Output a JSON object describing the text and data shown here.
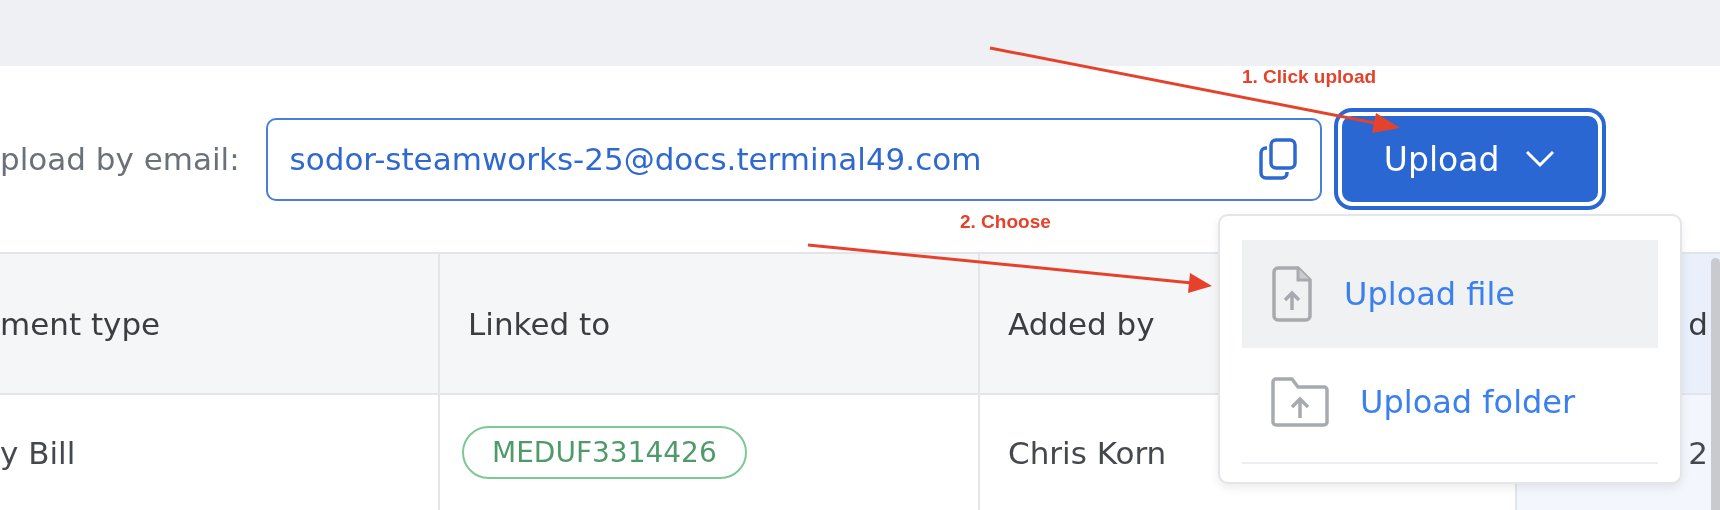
{
  "toolbar": {
    "email_label": "pload by email:",
    "email_address": "sodor-steamworks-25@docs.terminal49.com",
    "upload_button": {
      "label": "Upload",
      "expanded": true
    }
  },
  "upload_menu": {
    "items": [
      {
        "label": "Upload file",
        "kind": "file",
        "selected": true
      },
      {
        "label": "Upload folder",
        "kind": "folder",
        "selected": false
      }
    ]
  },
  "table": {
    "columns": [
      "ment type",
      "Linked to",
      "Added by",
      "d"
    ],
    "rows": [
      {
        "document_type": "y Bill",
        "linked_to": "MEDUF3314426",
        "added_by": "Chris Korn",
        "column_4": "2"
      }
    ]
  },
  "annotations": [
    {
      "label": "1. Click upload"
    },
    {
      "label": "2. Choose"
    }
  ]
}
